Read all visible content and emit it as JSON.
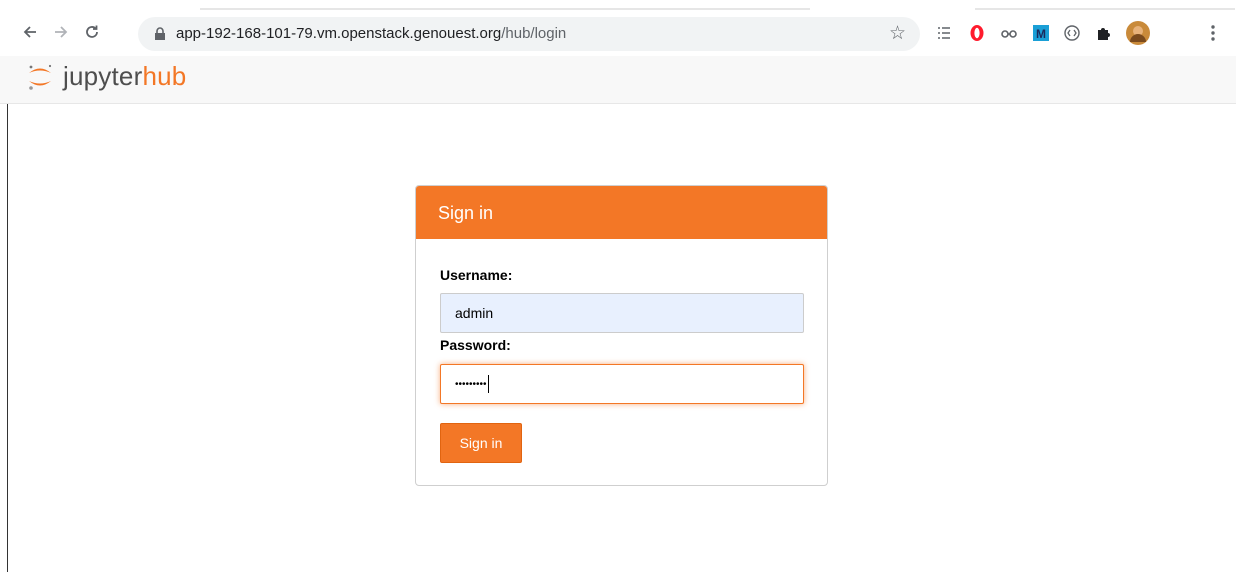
{
  "browser": {
    "url_host": "app-192-168-101-79.vm.openstack.genouest.org",
    "url_path": "/hub/login",
    "back_icon": "arrow-left-icon",
    "forward_icon": "arrow-right-icon",
    "reload_icon": "reload-icon",
    "bookmark_icon": "star-icon",
    "extensions": [
      "reading-list-icon",
      "opera-icon",
      "glasses-icon",
      "m-extension-icon",
      "code-icon",
      "puzzle-icon",
      "profile-avatar",
      "kebab-menu-icon"
    ]
  },
  "header": {
    "brand_part1": "jupyter",
    "brand_part2": "hub",
    "logo_icon": "jupyter-logo-icon"
  },
  "login": {
    "title": "Sign in",
    "username_label": "Username:",
    "username_value": "admin",
    "password_label": "Password:",
    "password_value": "•••••••••",
    "submit_label": "Sign in"
  },
  "colors": {
    "accent": "#f37726",
    "autofill_bg": "#e8f0fe",
    "header_bg": "#f8f8f8"
  }
}
